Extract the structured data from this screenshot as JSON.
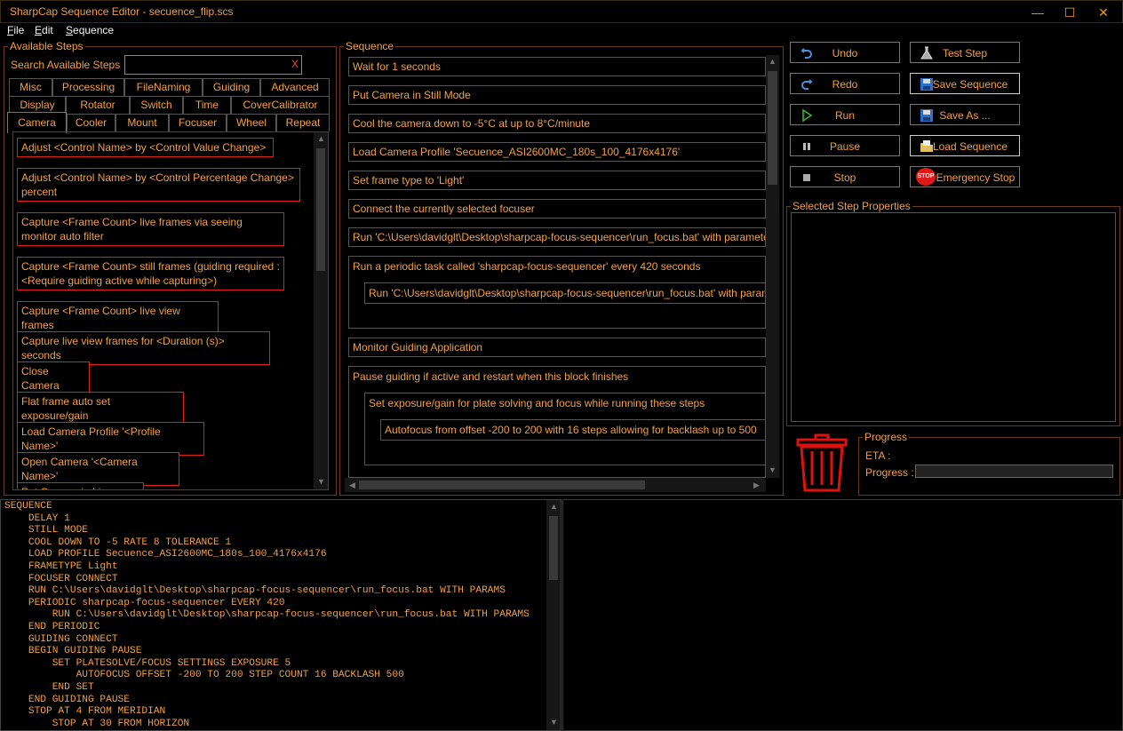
{
  "window": {
    "title": "SharpCap Sequence Editor - secuence_flip.scs",
    "minimize": "—",
    "maximize": "☐",
    "close": "✕"
  },
  "menu": [
    {
      "label": "File",
      "key": "F"
    },
    {
      "label": "Edit",
      "key": "E"
    },
    {
      "label": "Sequence",
      "key": "S"
    }
  ],
  "available_steps": {
    "title": "Available Steps",
    "search_label": "Search Available Steps",
    "search_value": "",
    "search_clear": "X",
    "tabs_row1": [
      "Misc",
      "Processing",
      "FileNaming",
      "Guiding",
      "Advanced"
    ],
    "tabs_row2": [
      "Display",
      "Rotator",
      "Switch",
      "Time",
      "CoverCalibrator"
    ],
    "tabs_row3": [
      "Camera",
      "Cooler",
      "Mount",
      "Focuser",
      "Wheel",
      "Repeat"
    ],
    "selected_tab": "Camera",
    "items": [
      "Adjust <Control Name> by <Control Value Change>",
      "Adjust <Control Name> by <Control Percentage Change> percent",
      "Capture <Frame Count> live frames via seeing monitor auto filter",
      "Capture <Frame Count> still frames (guiding required : <Require guiding active while capturing>)",
      "Capture <Frame Count> live view frames",
      "Capture live view frames for <Duration (s)> seconds",
      "Close Camera",
      "Flat frame auto set exposure/gain",
      "Load Camera Profile '<Profile Name>'",
      "Open Camera '<Camera Name>'",
      "Put Camera in Live Mode"
    ]
  },
  "sequence": {
    "title": "Sequence",
    "steps": [
      "Wait for 1 seconds",
      "Put Camera in Still Mode",
      "Cool the camera down to -5°C at up to 8°C/minute",
      "Load Camera Profile 'Secuence_ASI2600MC_180s_100_4176x4176'",
      "Set frame type to 'Light'",
      "Connect the currently selected focuser",
      "Run 'C:\\Users\\davidglt\\Desktop\\sharpcap-focus-sequencer\\run_focus.bat' with parameters",
      "Run a periodic task called 'sharpcap-focus-sequencer' every 420 seconds",
      "Run 'C:\\Users\\davidglt\\Desktop\\sharpcap-focus-sequencer\\run_focus.bat' with parameters",
      "Monitor Guiding Application",
      "Pause guiding if active and restart when this block finishes",
      "Set exposure/gain for plate solving and focus while running these steps",
      "Autofocus from offset -200 to 200 with 16 steps allowing for backlash up to 500"
    ]
  },
  "toolbar": {
    "undo": "Undo",
    "test_step": "Test Step",
    "redo": "Redo",
    "save_sequence": "Save Sequence",
    "run": "Run",
    "save_as": "Save As ...",
    "pause": "Pause",
    "load_sequence": "Load Sequence",
    "stop": "Stop",
    "emergency_stop": "Emergency Stop",
    "stop_badge": "STOP"
  },
  "properties": {
    "title": "Selected Step Properties"
  },
  "progress": {
    "title": "Progress",
    "eta_label": "ETA :",
    "eta_value": "",
    "progress_label": "Progress :",
    "progress_value": 0
  },
  "code": "SEQUENCE\n    DELAY 1\n    STILL MODE\n    COOL DOWN TO -5 RATE 8 TOLERANCE 1\n    LOAD PROFILE Secuence_ASI2600MC_180s_100_4176x4176\n    FRAMETYPE Light\n    FOCUSER CONNECT\n    RUN C:\\Users\\davidglt\\Desktop\\sharpcap-focus-sequencer\\run_focus.bat WITH PARAMS\n    PERIODIC sharpcap-focus-sequencer EVERY 420\n        RUN C:\\Users\\davidglt\\Desktop\\sharpcap-focus-sequencer\\run_focus.bat WITH PARAMS\n    END PERIODIC\n    GUIDING CONNECT\n    BEGIN GUIDING PAUSE\n        SET PLATESOLVE/FOCUS SETTINGS EXPOSURE 5\n            AUTOFOCUS OFFSET -200 TO 200 STEP COUNT 16 BACKLASH 500\n        END SET\n    END GUIDING PAUSE\n    STOP AT 4 FROM MERIDIAN\n        STOP AT 30 FROM HORIZON",
  "colors": {
    "accent": "#f0a040",
    "step_border": "#e02010",
    "background": "#000000",
    "trash": "#e01010",
    "stop_red": "#e01818"
  }
}
